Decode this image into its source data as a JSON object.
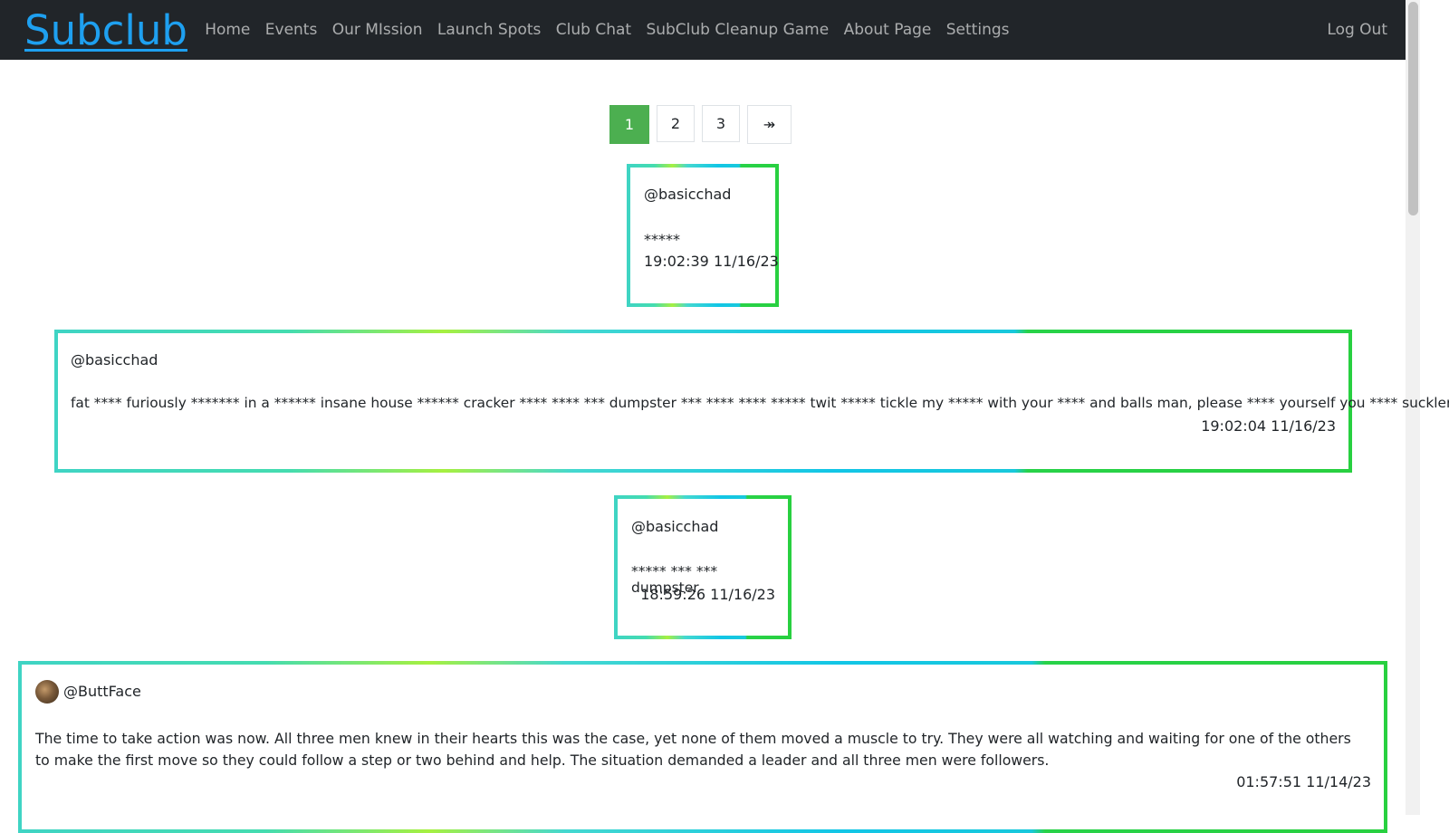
{
  "navbar": {
    "brand": "Subclub",
    "links": [
      "Home",
      "Events",
      "Our MIssion",
      "Launch Spots",
      "Club Chat",
      "SubClub Cleanup Game",
      "About Page",
      "Settings"
    ],
    "logout": "Log Out"
  },
  "pagination": {
    "pages": [
      "1",
      "2",
      "3"
    ],
    "active": "1",
    "next_label": "↠"
  },
  "posts": [
    {
      "user": "@basicchad",
      "message": "*****",
      "time": "19:02:39 11/16/23"
    },
    {
      "user": "@basicchad",
      "message": "fat **** furiously ******* in a ****** insane house ****** cracker **** **** *** dumpster *** **** **** ***** twit ***** tickle my ***** with your **** and balls man, please **** yourself you **** suckler",
      "time": "19:02:04 11/16/23"
    },
    {
      "user": "@basicchad",
      "message": "***** *** *** dumpster",
      "time": "18:59:26 11/16/23"
    },
    {
      "user": "@ButtFace",
      "message": "The time to take action was now. All three men knew in their hearts this was the case, yet none of them moved a muscle to try. They were all watching and waiting for one of the others to make the first move so they could follow a step or two behind and help. The situation demanded a leader and all three men were followers.",
      "time": "01:57:51 11/14/23"
    }
  ]
}
